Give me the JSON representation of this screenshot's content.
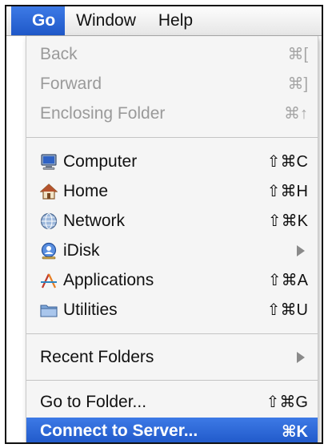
{
  "menubar": {
    "items": [
      {
        "label": "Go",
        "active": true
      },
      {
        "label": "Window",
        "active": false
      },
      {
        "label": "Help",
        "active": false
      }
    ]
  },
  "go_menu": {
    "back": {
      "label": "Back",
      "shortcut": "⌘[",
      "enabled": false
    },
    "forward": {
      "label": "Forward",
      "shortcut": "⌘]",
      "enabled": false
    },
    "enclosing_folder": {
      "label": "Enclosing Folder",
      "shortcut": "⌘↑",
      "enabled": false
    },
    "computer": {
      "label": "Computer",
      "shortcut": "⇧⌘C",
      "icon": "computer-icon"
    },
    "home": {
      "label": "Home",
      "shortcut": "⇧⌘H",
      "icon": "home-icon"
    },
    "network": {
      "label": "Network",
      "shortcut": "⇧⌘K",
      "icon": "network-icon"
    },
    "idisk": {
      "label": "iDisk",
      "submenu": true,
      "icon": "idisk-icon"
    },
    "applications": {
      "label": "Applications",
      "shortcut": "⇧⌘A",
      "icon": "applications-icon"
    },
    "utilities": {
      "label": "Utilities",
      "shortcut": "⇧⌘U",
      "icon": "utilities-folder-icon"
    },
    "recent_folders": {
      "label": "Recent Folders",
      "submenu": true
    },
    "go_to_folder": {
      "label": "Go to Folder...",
      "shortcut": "⇧⌘G"
    },
    "connect_to_server": {
      "label": "Connect to Server...",
      "shortcut": "⌘K",
      "selected": true
    }
  },
  "colors": {
    "selection": "#2a66d6",
    "disabled_text": "#9a9a9a"
  }
}
